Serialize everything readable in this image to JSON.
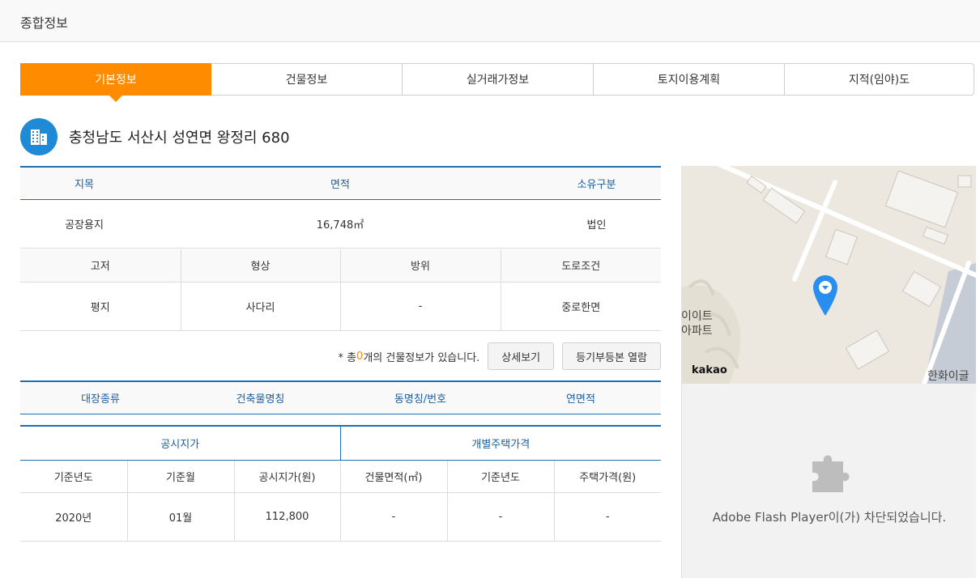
{
  "header": {
    "title": "종합정보"
  },
  "tabs": [
    {
      "label": "기본정보",
      "active": true
    },
    {
      "label": "건물정보",
      "active": false
    },
    {
      "label": "실거래가정보",
      "active": false
    },
    {
      "label": "토지이용계획",
      "active": false
    },
    {
      "label": "지적(임야)도",
      "active": false
    }
  ],
  "address": {
    "icon": "building-icon",
    "text": "충청남도 서산시 성연면 왕정리 680"
  },
  "land": {
    "headers": [
      "지목",
      "면적",
      "소유구분"
    ],
    "values": [
      "공장용지",
      "16,748㎡",
      "법인"
    ]
  },
  "terrain": {
    "headers": [
      "고저",
      "형상",
      "방위",
      "도로조건"
    ],
    "values": [
      "평지",
      "사다리",
      "-",
      "중로한면"
    ]
  },
  "building_notice": {
    "prefix": "* 총 ",
    "count": "0",
    "suffix": "개의 건물정보가 있습니다.",
    "detail_button": "상세보기",
    "registry_button": "등기부등본 열람"
  },
  "building_list": {
    "headers": [
      "대장종류",
      "건축물명칭",
      "동명칭/번호",
      "연면적"
    ]
  },
  "price": {
    "groups": [
      "공시지가",
      "개별주택가격"
    ],
    "headers": [
      "기준년도",
      "기준월",
      "공시지가(원)",
      "건물면적(㎡)",
      "기준년도",
      "주택가격(원)"
    ],
    "values": [
      "2020년",
      "01월",
      "112,800",
      "-",
      "-",
      "-"
    ]
  },
  "map": {
    "provider": "kakao",
    "labels": [
      "이이트",
      "아파트",
      "한화이글스"
    ]
  },
  "flash": {
    "icon": "puzzle-icon",
    "message": "Adobe Flash Player이(가) 차단되었습니다."
  },
  "colors": {
    "accent": "#ff8c00",
    "primary": "#1a6fb5",
    "header_text": "#1a5d9e"
  }
}
